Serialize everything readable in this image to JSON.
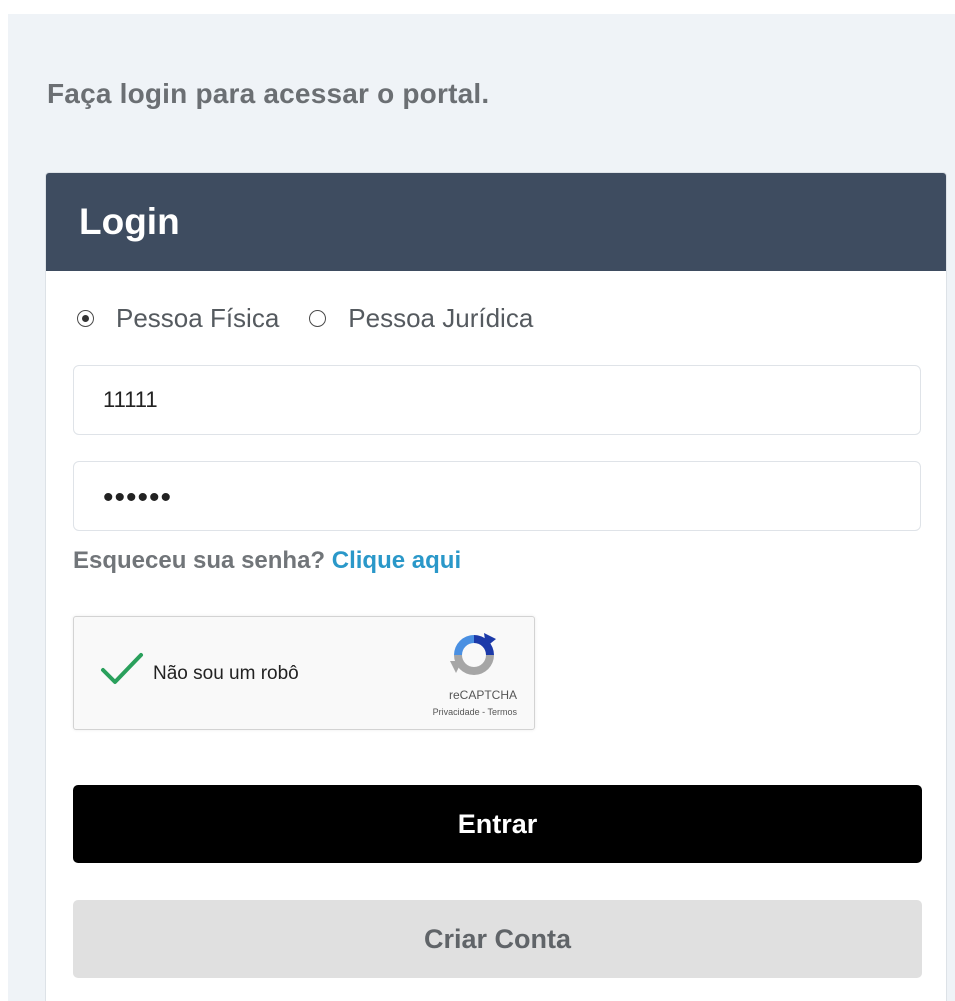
{
  "intro_text": "Faça login para acessar o portal.",
  "card": {
    "title": "Login"
  },
  "person_type": {
    "options": [
      {
        "label": "Pessoa Física",
        "selected": true
      },
      {
        "label": "Pessoa Jurídica",
        "selected": false
      }
    ]
  },
  "form": {
    "document_value": "11111",
    "password_masked": "••••••"
  },
  "forgot": {
    "text": "Esqueceu sua senha?",
    "link": "Clique aqui"
  },
  "captcha": {
    "label": "Não sou um robô",
    "brand": "reCAPTCHA",
    "terms": "Privacidade - Termos",
    "checked": true
  },
  "buttons": {
    "login": "Entrar",
    "create_account": "Criar Conta"
  },
  "colors": {
    "header_bg": "#3e4c60",
    "link": "#2a98c9",
    "primary_button": "#000000",
    "secondary_button": "#e0e0e0",
    "check_green": "#2aa05c"
  }
}
